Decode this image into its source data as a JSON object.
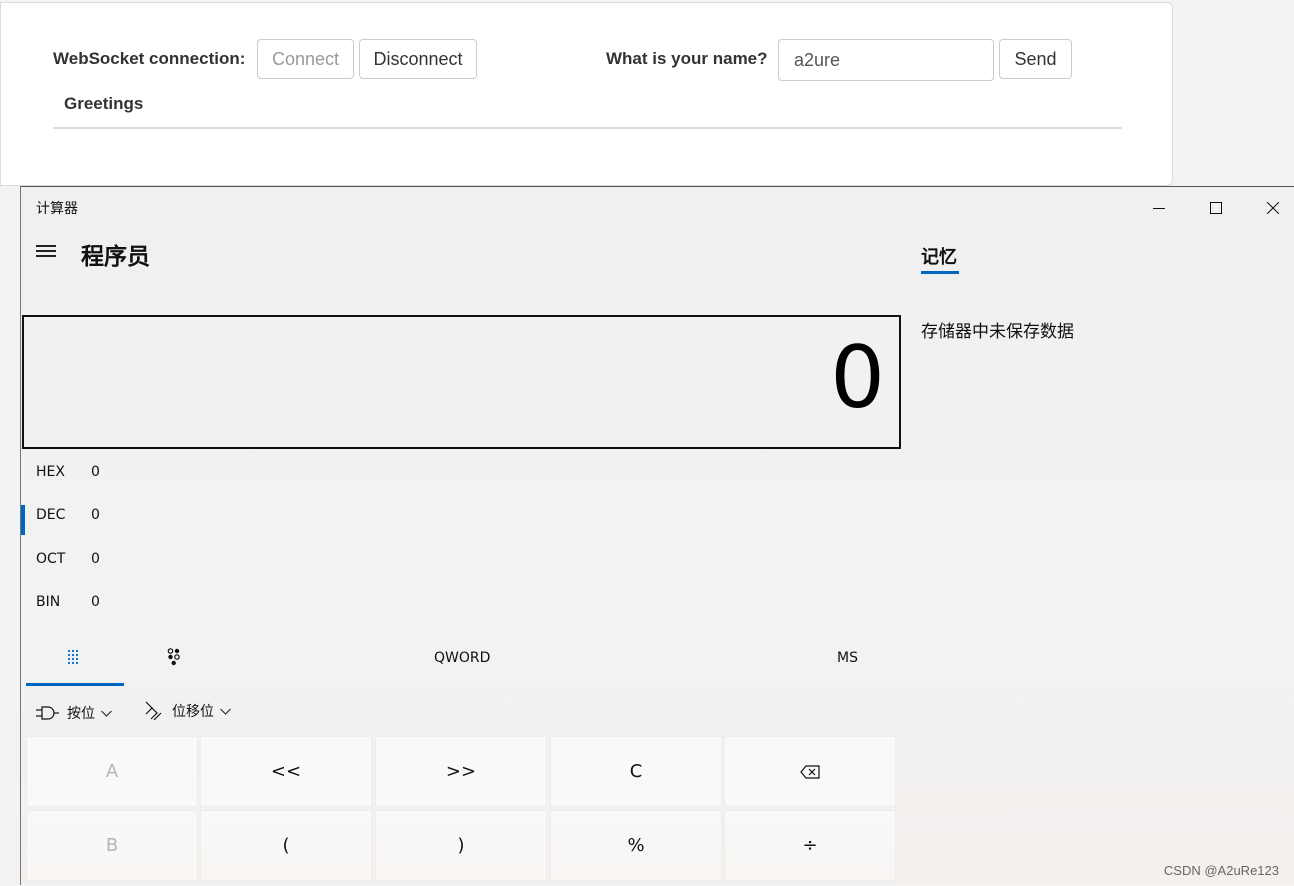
{
  "web": {
    "connection_label": "WebSocket connection:",
    "connect_button": "Connect",
    "disconnect_button": "Disconnect",
    "name_label": "What is your name?",
    "name_input_value": "a2ure",
    "send_button": "Send",
    "greetings_header": "Greetings"
  },
  "calculator": {
    "window_title": "计算器",
    "mode_title": "程序员",
    "display_value": "0",
    "radix": [
      {
        "name": "HEX",
        "value": "0",
        "selected": false
      },
      {
        "name": "DEC",
        "value": "0",
        "selected": true
      },
      {
        "name": "OCT",
        "value": "0",
        "selected": false
      },
      {
        "name": "BIN",
        "value": "0",
        "selected": false
      }
    ],
    "word_size": "QWORD",
    "ms_label": "MS",
    "bitwise_label": "按位",
    "bitshift_label": "位移位",
    "memory_tab": "记忆",
    "memory_empty": "存储器中未保存数据",
    "keys_row1": [
      "A",
      "<<",
      ">>",
      "C",
      "⌫"
    ],
    "keys_row2": [
      "B",
      "(",
      ")",
      "%",
      "÷"
    ]
  },
  "watermark": "CSDN @A2uRe123",
  "colors": {
    "accent": "#0067c0"
  },
  "icons": [
    "hamburger-icon",
    "minimize-icon",
    "maximize-icon",
    "close-icon",
    "full-keypad-icon",
    "bit-toggle-icon",
    "bitwise-gate-icon",
    "bitshift-icon",
    "chevron-down-icon",
    "backspace-icon"
  ]
}
